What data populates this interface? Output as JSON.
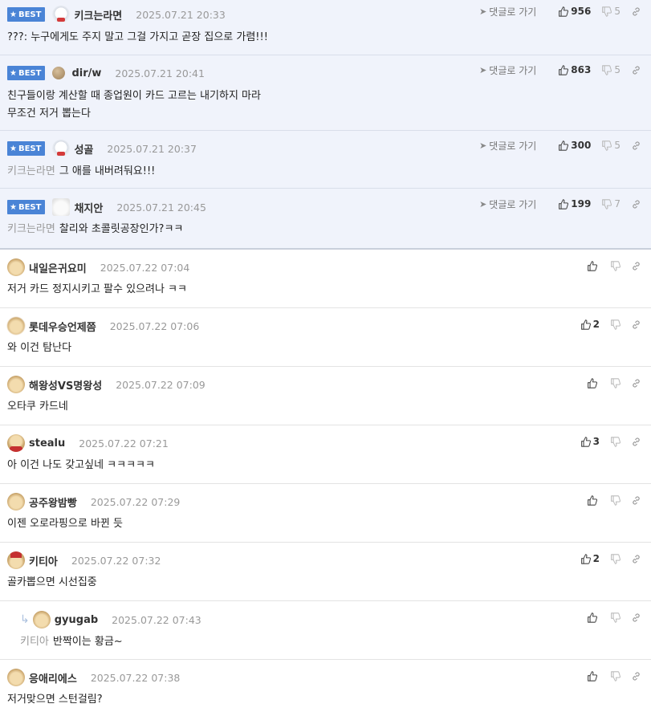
{
  "best_label": "BEST",
  "goto_label": "댓글로 가기",
  "best_comments": [
    {
      "nick": "키크는라면",
      "date": "2025.07.21 20:33",
      "mention": "",
      "text": "???: 누구에게도 주지 말고 그걸 가지고 곧장 집으로 가렴!!!",
      "likes": "956",
      "dislikes": "5"
    },
    {
      "nick": "dir/w",
      "date": "2025.07.21 20:41",
      "mention": "",
      "text": "친구들이랑 계산할 때 종업원이 카드 고르는 내기하지 마라\n무조건 저거 뽑는다",
      "likes": "863",
      "dislikes": "5"
    },
    {
      "nick": "성골",
      "date": "2025.07.21 20:37",
      "mention": "키크는라면",
      "text": "그 애를 내버려둬요!!!",
      "likes": "300",
      "dislikes": "5"
    },
    {
      "nick": "채지안",
      "date": "2025.07.21 20:45",
      "mention": "키크는라면",
      "text": "찰리와 초콜릿공장인가?ㅋㅋ",
      "likes": "199",
      "dislikes": "7"
    }
  ],
  "comments": [
    {
      "nick": "내일은귀요미",
      "date": "2025.07.22 07:04",
      "mention": "",
      "text": "저거 카드 정지시키고 팔수 있으려나 ㅋㅋ",
      "likes": ""
    },
    {
      "nick": "롯데우승언제쯤",
      "date": "2025.07.22 07:06",
      "mention": "",
      "text": "와 이건 탐난다",
      "likes": "2"
    },
    {
      "nick": "해왕성VS명왕성",
      "date": "2025.07.22 07:09",
      "mention": "",
      "text": "오타쿠 카드네",
      "likes": ""
    },
    {
      "nick": "stealu",
      "date": "2025.07.22 07:21",
      "mention": "",
      "text": "아 이건 나도 갖고싶네 ㅋㅋㅋㅋㅋ",
      "likes": "3"
    },
    {
      "nick": "공주왕밤빵",
      "date": "2025.07.22 07:29",
      "mention": "",
      "text": "이젠 오로라핑으로 바뀐 듯",
      "likes": ""
    },
    {
      "nick": "키티아",
      "date": "2025.07.22 07:32",
      "mention": "",
      "text": "골카뽑으면 시선집중",
      "likes": "2"
    },
    {
      "nick": "gyugab",
      "date": "2025.07.22 07:43",
      "mention": "키티아",
      "text": "반짝이는 황금~",
      "likes": ""
    },
    {
      "nick": "응애리에스",
      "date": "2025.07.22 07:38",
      "mention": "",
      "text": "저거맞으면 스턴걸림?",
      "likes": ""
    }
  ]
}
